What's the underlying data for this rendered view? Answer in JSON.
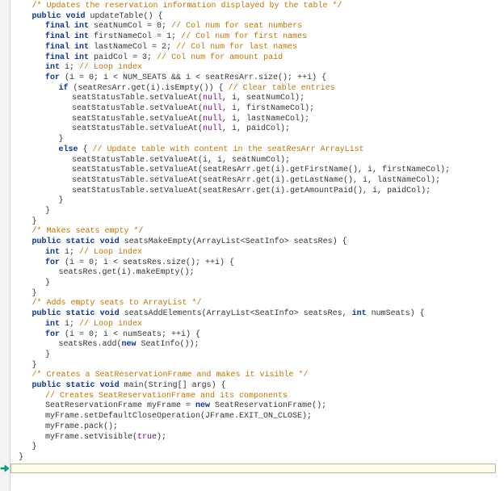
{
  "highlight_line_index": 41,
  "lines": [
    {
      "indent": 3,
      "tokens": [
        {
          "cls": "c",
          "t": "/* Updates the reservation information displayed by the table */"
        }
      ]
    },
    {
      "indent": 3,
      "tokens": [
        {
          "cls": "k",
          "t": "public"
        },
        {
          "cls": "m",
          "t": " "
        },
        {
          "cls": "k",
          "t": "void"
        },
        {
          "cls": "m",
          "t": " updateTable() {"
        }
      ]
    },
    {
      "indent": 6,
      "tokens": [
        {
          "cls": "k",
          "t": "final"
        },
        {
          "cls": "m",
          "t": " "
        },
        {
          "cls": "k",
          "t": "int"
        },
        {
          "cls": "m",
          "t": " seatNumCol = 0;   "
        },
        {
          "cls": "c",
          "t": "// Col num for seat numbers"
        }
      ]
    },
    {
      "indent": 6,
      "tokens": [
        {
          "cls": "k",
          "t": "final"
        },
        {
          "cls": "m",
          "t": " "
        },
        {
          "cls": "k",
          "t": "int"
        },
        {
          "cls": "m",
          "t": " firstNameCol = 1; "
        },
        {
          "cls": "c",
          "t": "// Col num for first names"
        }
      ]
    },
    {
      "indent": 6,
      "tokens": [
        {
          "cls": "k",
          "t": "final"
        },
        {
          "cls": "m",
          "t": " "
        },
        {
          "cls": "k",
          "t": "int"
        },
        {
          "cls": "m",
          "t": " lastNameCol = 2;  "
        },
        {
          "cls": "c",
          "t": "// Col num for last names"
        }
      ]
    },
    {
      "indent": 6,
      "tokens": [
        {
          "cls": "k",
          "t": "final"
        },
        {
          "cls": "m",
          "t": " "
        },
        {
          "cls": "k",
          "t": "int"
        },
        {
          "cls": "m",
          "t": " paidCol = 3;      "
        },
        {
          "cls": "c",
          "t": "// Col num for amount paid"
        }
      ]
    },
    {
      "indent": 6,
      "tokens": [
        {
          "cls": "k",
          "t": "int"
        },
        {
          "cls": "m",
          "t": " i;                    "
        },
        {
          "cls": "c",
          "t": "// Loop index"
        }
      ]
    },
    {
      "indent": 0,
      "tokens": [
        {
          "cls": "m",
          "t": " "
        }
      ]
    },
    {
      "indent": 6,
      "tokens": [
        {
          "cls": "k",
          "t": "for"
        },
        {
          "cls": "m",
          "t": " (i = 0; i < NUM_SEATS && i < seatResArr.size(); ++i) {"
        }
      ]
    },
    {
      "indent": 9,
      "tokens": [
        {
          "cls": "k",
          "t": "if"
        },
        {
          "cls": "m",
          "t": " (seatResArr.get(i).isEmpty()) { "
        },
        {
          "cls": "c",
          "t": "// Clear table entries"
        }
      ]
    },
    {
      "indent": 12,
      "tokens": [
        {
          "cls": "m",
          "t": "seatStatusTable.setValueAt("
        },
        {
          "cls": "lit",
          "t": "null"
        },
        {
          "cls": "m",
          "t": ", i, seatNumCol);"
        }
      ]
    },
    {
      "indent": 12,
      "tokens": [
        {
          "cls": "m",
          "t": "seatStatusTable.setValueAt("
        },
        {
          "cls": "lit",
          "t": "null"
        },
        {
          "cls": "m",
          "t": ", i, firstNameCol);"
        }
      ]
    },
    {
      "indent": 12,
      "tokens": [
        {
          "cls": "m",
          "t": "seatStatusTable.setValueAt("
        },
        {
          "cls": "lit",
          "t": "null"
        },
        {
          "cls": "m",
          "t": ", i, lastNameCol);"
        }
      ]
    },
    {
      "indent": 12,
      "tokens": [
        {
          "cls": "m",
          "t": "seatStatusTable.setValueAt("
        },
        {
          "cls": "lit",
          "t": "null"
        },
        {
          "cls": "m",
          "t": ", i, paidCol);"
        }
      ]
    },
    {
      "indent": 9,
      "tokens": [
        {
          "cls": "m",
          "t": "}"
        }
      ]
    },
    {
      "indent": 9,
      "tokens": [
        {
          "cls": "k",
          "t": "else"
        },
        {
          "cls": "m",
          "t": " {                         "
        },
        {
          "cls": "c",
          "t": "// Update table with content in the seatResArr ArrayList"
        }
      ]
    },
    {
      "indent": 12,
      "tokens": [
        {
          "cls": "m",
          "t": "seatStatusTable.setValueAt(i, i, seatNumCol);"
        }
      ]
    },
    {
      "indent": 12,
      "tokens": [
        {
          "cls": "m",
          "t": "seatStatusTable.setValueAt(seatResArr.get(i).getFirstName(), i, firstNameCol);"
        }
      ]
    },
    {
      "indent": 12,
      "tokens": [
        {
          "cls": "m",
          "t": "seatStatusTable.setValueAt(seatResArr.get(i).getLastName(), i, lastNameCol);"
        }
      ]
    },
    {
      "indent": 12,
      "tokens": [
        {
          "cls": "m",
          "t": "seatStatusTable.setValueAt(seatResArr.get(i).getAmountPaid(), i, paidCol);"
        }
      ]
    },
    {
      "indent": 9,
      "tokens": [
        {
          "cls": "m",
          "t": "}"
        }
      ]
    },
    {
      "indent": 6,
      "tokens": [
        {
          "cls": "m",
          "t": "}"
        }
      ]
    },
    {
      "indent": 3,
      "tokens": [
        {
          "cls": "m",
          "t": "}"
        }
      ]
    },
    {
      "indent": 0,
      "tokens": [
        {
          "cls": "m",
          "t": " "
        }
      ]
    },
    {
      "indent": 3,
      "tokens": [
        {
          "cls": "c",
          "t": "/* Makes seats empty */"
        }
      ]
    },
    {
      "indent": 3,
      "tokens": [
        {
          "cls": "k",
          "t": "public"
        },
        {
          "cls": "m",
          "t": " "
        },
        {
          "cls": "k",
          "t": "static"
        },
        {
          "cls": "m",
          "t": " "
        },
        {
          "cls": "k",
          "t": "void"
        },
        {
          "cls": "m",
          "t": " seatsMakeEmpty(ArrayList<SeatInfo> seatsRes) {"
        }
      ]
    },
    {
      "indent": 6,
      "tokens": [
        {
          "cls": "k",
          "t": "int"
        },
        {
          "cls": "m",
          "t": " i;     "
        },
        {
          "cls": "c",
          "t": "// Loop index"
        }
      ]
    },
    {
      "indent": 0,
      "tokens": [
        {
          "cls": "m",
          "t": " "
        }
      ]
    },
    {
      "indent": 6,
      "tokens": [
        {
          "cls": "k",
          "t": "for"
        },
        {
          "cls": "m",
          "t": " (i = 0; i < seatsRes.size(); ++i) {"
        }
      ]
    },
    {
      "indent": 9,
      "tokens": [
        {
          "cls": "m",
          "t": "seatsRes.get(i).makeEmpty();"
        }
      ]
    },
    {
      "indent": 6,
      "tokens": [
        {
          "cls": "m",
          "t": "}"
        }
      ]
    },
    {
      "indent": 3,
      "tokens": [
        {
          "cls": "m",
          "t": "}"
        }
      ]
    },
    {
      "indent": 0,
      "tokens": [
        {
          "cls": "m",
          "t": " "
        }
      ]
    },
    {
      "indent": 3,
      "tokens": [
        {
          "cls": "c",
          "t": "/* Adds empty seats to ArrayList */"
        }
      ]
    },
    {
      "indent": 3,
      "tokens": [
        {
          "cls": "k",
          "t": "public"
        },
        {
          "cls": "m",
          "t": " "
        },
        {
          "cls": "k",
          "t": "static"
        },
        {
          "cls": "m",
          "t": " "
        },
        {
          "cls": "k",
          "t": "void"
        },
        {
          "cls": "m",
          "t": " seatsAddElements(ArrayList<SeatInfo> seatsRes, "
        },
        {
          "cls": "k",
          "t": "int"
        },
        {
          "cls": "m",
          "t": " numSeats) {"
        }
      ]
    },
    {
      "indent": 6,
      "tokens": [
        {
          "cls": "k",
          "t": "int"
        },
        {
          "cls": "m",
          "t": " i;     "
        },
        {
          "cls": "c",
          "t": "// Loop index"
        }
      ]
    },
    {
      "indent": 0,
      "tokens": [
        {
          "cls": "m",
          "t": " "
        }
      ]
    },
    {
      "indent": 6,
      "tokens": [
        {
          "cls": "k",
          "t": "for"
        },
        {
          "cls": "m",
          "t": " (i = 0; i < numSeats; ++i) {"
        }
      ]
    },
    {
      "indent": 9,
      "tokens": [
        {
          "cls": "m",
          "t": "seatsRes.add("
        },
        {
          "cls": "k",
          "t": "new"
        },
        {
          "cls": "m",
          "t": " SeatInfo());"
        }
      ]
    },
    {
      "indent": 6,
      "tokens": [
        {
          "cls": "m",
          "t": "}"
        }
      ]
    },
    {
      "indent": 3,
      "tokens": [
        {
          "cls": "m",
          "t": "}"
        }
      ]
    },
    {
      "indent": 0,
      "tokens": [
        {
          "cls": "m",
          "t": " "
        }
      ]
    },
    {
      "indent": 3,
      "tokens": [
        {
          "cls": "c",
          "t": "/* Creates a SeatReservationFrame and makes it visible */"
        }
      ]
    },
    {
      "indent": 3,
      "tokens": [
        {
          "cls": "k",
          "t": "public"
        },
        {
          "cls": "m",
          "t": " "
        },
        {
          "cls": "k",
          "t": "static"
        },
        {
          "cls": "m",
          "t": " "
        },
        {
          "cls": "k",
          "t": "void"
        },
        {
          "cls": "m",
          "t": " main(String[] args) {"
        }
      ]
    },
    {
      "indent": 6,
      "tokens": [
        {
          "cls": "c",
          "t": "// Creates SeatReservationFrame and its components"
        }
      ]
    },
    {
      "indent": 6,
      "tokens": [
        {
          "cls": "m",
          "t": "SeatReservationFrame myFrame = "
        },
        {
          "cls": "k",
          "t": "new"
        },
        {
          "cls": "m",
          "t": " SeatReservationFrame();"
        }
      ]
    },
    {
      "indent": 0,
      "tokens": [
        {
          "cls": "m",
          "t": " "
        }
      ]
    },
    {
      "indent": 6,
      "tokens": [
        {
          "cls": "m",
          "t": "myFrame.setDefaultCloseOperation(JFrame.EXIT_ON_CLOSE);"
        }
      ]
    },
    {
      "indent": 6,
      "tokens": [
        {
          "cls": "m",
          "t": "myFrame.pack();"
        }
      ]
    },
    {
      "indent": 6,
      "tokens": [
        {
          "cls": "m",
          "t": "myFrame.setVisible("
        },
        {
          "cls": "lit",
          "t": "true"
        },
        {
          "cls": "m",
          "t": ");"
        }
      ]
    },
    {
      "indent": 3,
      "tokens": [
        {
          "cls": "m",
          "t": "}"
        }
      ]
    },
    {
      "indent": 0,
      "tokens": [
        {
          "cls": "m",
          "t": "}"
        }
      ]
    }
  ]
}
